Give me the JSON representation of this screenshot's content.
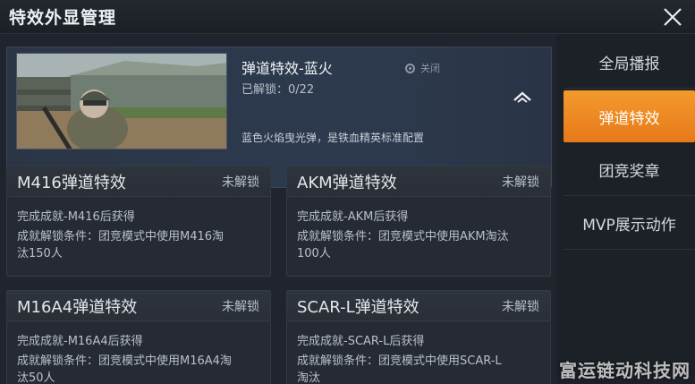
{
  "header": {
    "title": "特效外显管理"
  },
  "featured": {
    "title": "弹道特效-蓝火",
    "progress": "已解锁：0/22",
    "toggle_label": "关闭",
    "description": "蓝色火焰曳光弹，是铁血精英标准配置"
  },
  "cards": [
    {
      "name": "M416弹道特效",
      "status": "未解锁",
      "how": "完成成就-M416后获得",
      "condition": "成就解锁条件：团竞模式中使用M416淘汰150人"
    },
    {
      "name": "AKM弹道特效",
      "status": "未解锁",
      "how": "完成成就-AKM后获得",
      "condition": "成就解锁条件：团竞模式中使用AKM淘汰100人"
    },
    {
      "name": "M16A4弹道特效",
      "status": "未解锁",
      "how": "完成成就-M16A4后获得",
      "condition": "成就解锁条件：团竞模式中使用M16A4淘汰50人"
    },
    {
      "name": "SCAR-L弹道特效",
      "status": "未解锁",
      "how": "完成成就-SCAR-L后获得",
      "condition": "成就解锁条件：团竞模式中使用SCAR-L淘汰"
    }
  ],
  "sidebar": {
    "items": [
      {
        "label": "全局播报",
        "active": false
      },
      {
        "label": "弹道特效",
        "active": true
      },
      {
        "label": "团竞奖章",
        "active": false
      },
      {
        "label": "MVP展示动作",
        "active": false
      }
    ]
  },
  "watermark": "富运链动科技网",
  "colors": {
    "accent": "#f0902a",
    "background": "#1b2027",
    "card": "#262b33"
  }
}
